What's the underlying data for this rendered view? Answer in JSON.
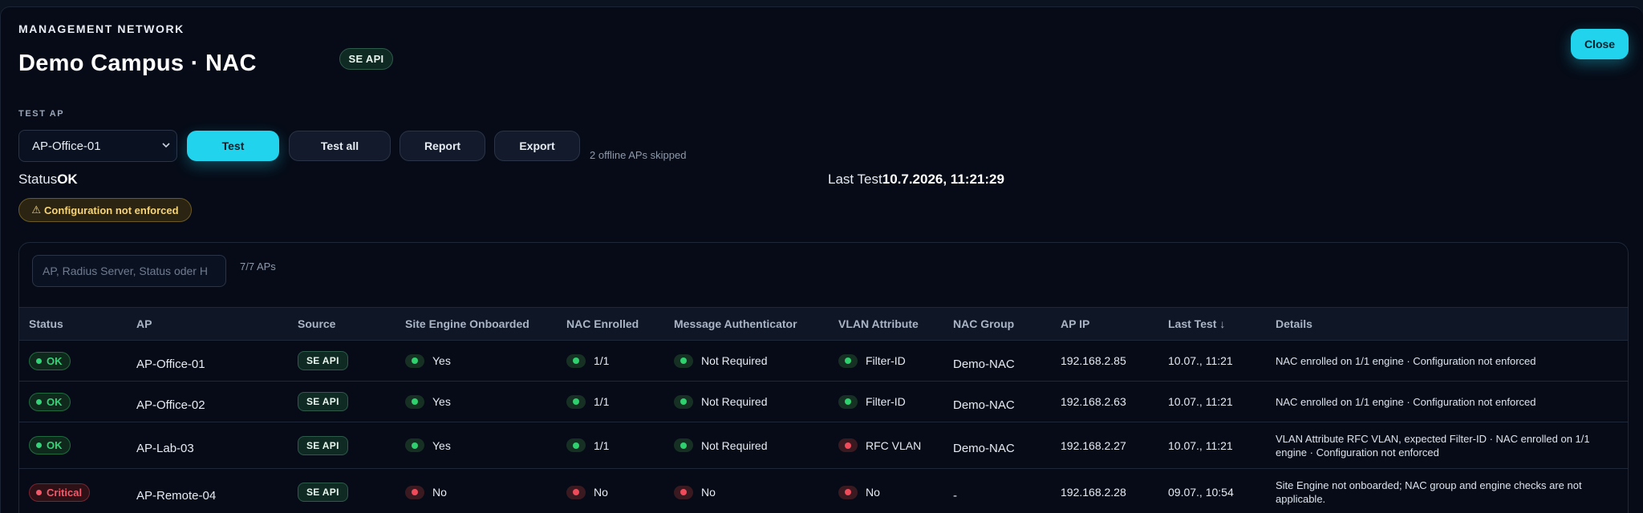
{
  "header": {
    "eyebrow": "MANAGEMENT NETWORK",
    "title": "Demo Campus · NAC",
    "badge": "SE API",
    "close_label": "Close"
  },
  "test_ap": {
    "section_label": "TEST AP",
    "selected_ap": "AP-Office-01",
    "test_label": "Test",
    "test_all_label": "Test all",
    "report_label": "Report",
    "export_label": "Export",
    "skipped_text": "2 offline APs skipped"
  },
  "summary": {
    "status_label": "Status",
    "status_value": "OK",
    "last_test_label": "Last Test",
    "last_test_value": "10.7.2026, 11:21:29",
    "warning": "Configuration not enforced"
  },
  "table": {
    "search_placeholder": "AP, Radius Server, Status oder H",
    "count": "7/7 APs",
    "columns": [
      "Status",
      "AP",
      "Source",
      "Site Engine Onboarded",
      "NAC Enrolled",
      "Message Authenticator",
      "VLAN Attribute",
      "NAC Group",
      "AP IP",
      "Last Test ↓",
      "Details"
    ],
    "rows": [
      {
        "status": "OK",
        "ap": "AP-Office-01",
        "source": "SE API",
        "onboarded": "Yes",
        "enrolled": "1/1",
        "msg_auth": "Not Required",
        "vlan": "Filter-ID",
        "group": "Demo-NAC",
        "ip": "192.168.2.85",
        "last": "10.07., 11:21",
        "details": "NAC enrolled on 1/1 engine · Configuration not enforced"
      },
      {
        "status": "OK",
        "ap": "AP-Office-02",
        "source": "SE API",
        "onboarded": "Yes",
        "enrolled": "1/1",
        "msg_auth": "Not Required",
        "vlan": "Filter-ID",
        "group": "Demo-NAC",
        "ip": "192.168.2.63",
        "last": "10.07., 11:21",
        "details": "NAC enrolled on 1/1 engine · Configuration not enforced"
      },
      {
        "status": "OK",
        "ap": "AP-Lab-03",
        "source": "SE API",
        "onboarded": "Yes",
        "enrolled": "1/1",
        "msg_auth": "Not Required",
        "vlan": "RFC VLAN",
        "group": "Demo-NAC",
        "ip": "192.168.2.27",
        "last": "10.07., 11:21",
        "details": "VLAN Attribute RFC VLAN, expected Filter-ID · NAC enrolled on 1/1 engine · Configuration not enforced"
      },
      {
        "status": "Critical",
        "ap": "AP-Remote-04",
        "source": "SE API",
        "onboarded": "No",
        "enrolled": "No",
        "msg_auth": "No",
        "vlan": "No",
        "group": "-",
        "ip": "192.168.2.28",
        "last": "09.07., 10:54",
        "details": "Site Engine not onboarded; NAC group and engine checks are not applicable."
      }
    ]
  },
  "colors": {
    "accent": "#22d3ee",
    "ok": "#34d37a",
    "critical": "#f15a6a",
    "warning": "#f6d47a",
    "background": "#060b17"
  }
}
